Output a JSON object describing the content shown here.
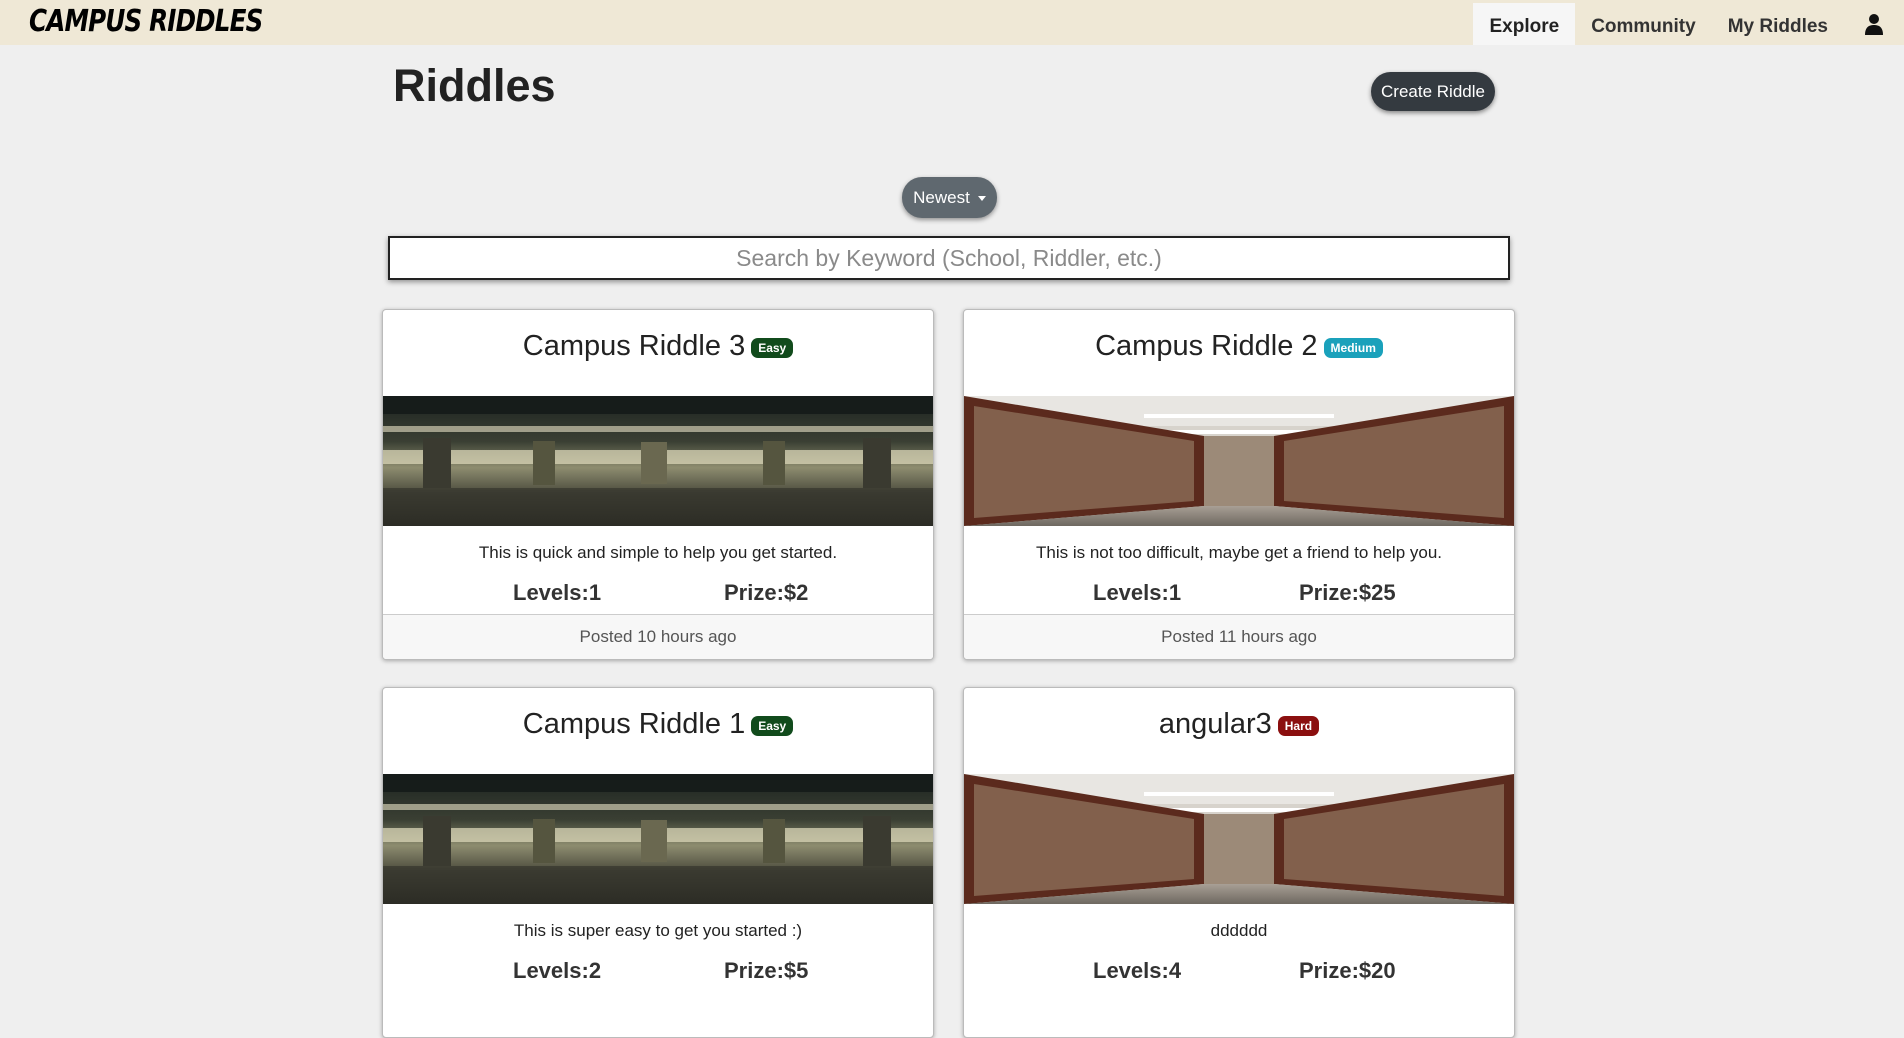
{
  "nav": {
    "logo": "CAMPUS RIDDLES",
    "links": [
      "Explore",
      "Community",
      "My Riddles"
    ],
    "user_icon": "user-icon"
  },
  "page": {
    "title": "Riddles",
    "create_label": "Create Riddle",
    "sort_label": "Newest",
    "search_placeholder": "Search by Keyword (School, Riddler, etc.)"
  },
  "colors": {
    "easy": "#114b1c",
    "medium": "#1aa1bb",
    "hard": "#8b0f0f",
    "primary_dark": "#343a40"
  },
  "cards": [
    {
      "title": "Campus Riddle 3",
      "difficulty": "Easy",
      "image": "parking-garage",
      "description": "This is quick and simple to help you get started.",
      "levels": "Levels:1",
      "prize": "Prize:$2",
      "posted": "Posted 10 hours ago"
    },
    {
      "title": "Campus Riddle 2",
      "difficulty": "Medium",
      "image": "library-aisle",
      "description": "This is not too difficult, maybe get a friend to help you.",
      "levels": "Levels:1",
      "prize": "Prize:$25",
      "posted": "Posted 11 hours ago"
    },
    {
      "title": "Campus Riddle 1",
      "difficulty": "Easy",
      "image": "parking-garage",
      "description": "This is super easy to get you started :)",
      "levels": "Levels:2",
      "prize": "Prize:$5",
      "posted": ""
    },
    {
      "title": "angular3",
      "difficulty": "Hard",
      "image": "library-aisle",
      "description": "dddddd",
      "levels": "Levels:4",
      "prize": "Prize:$20",
      "posted": ""
    }
  ]
}
